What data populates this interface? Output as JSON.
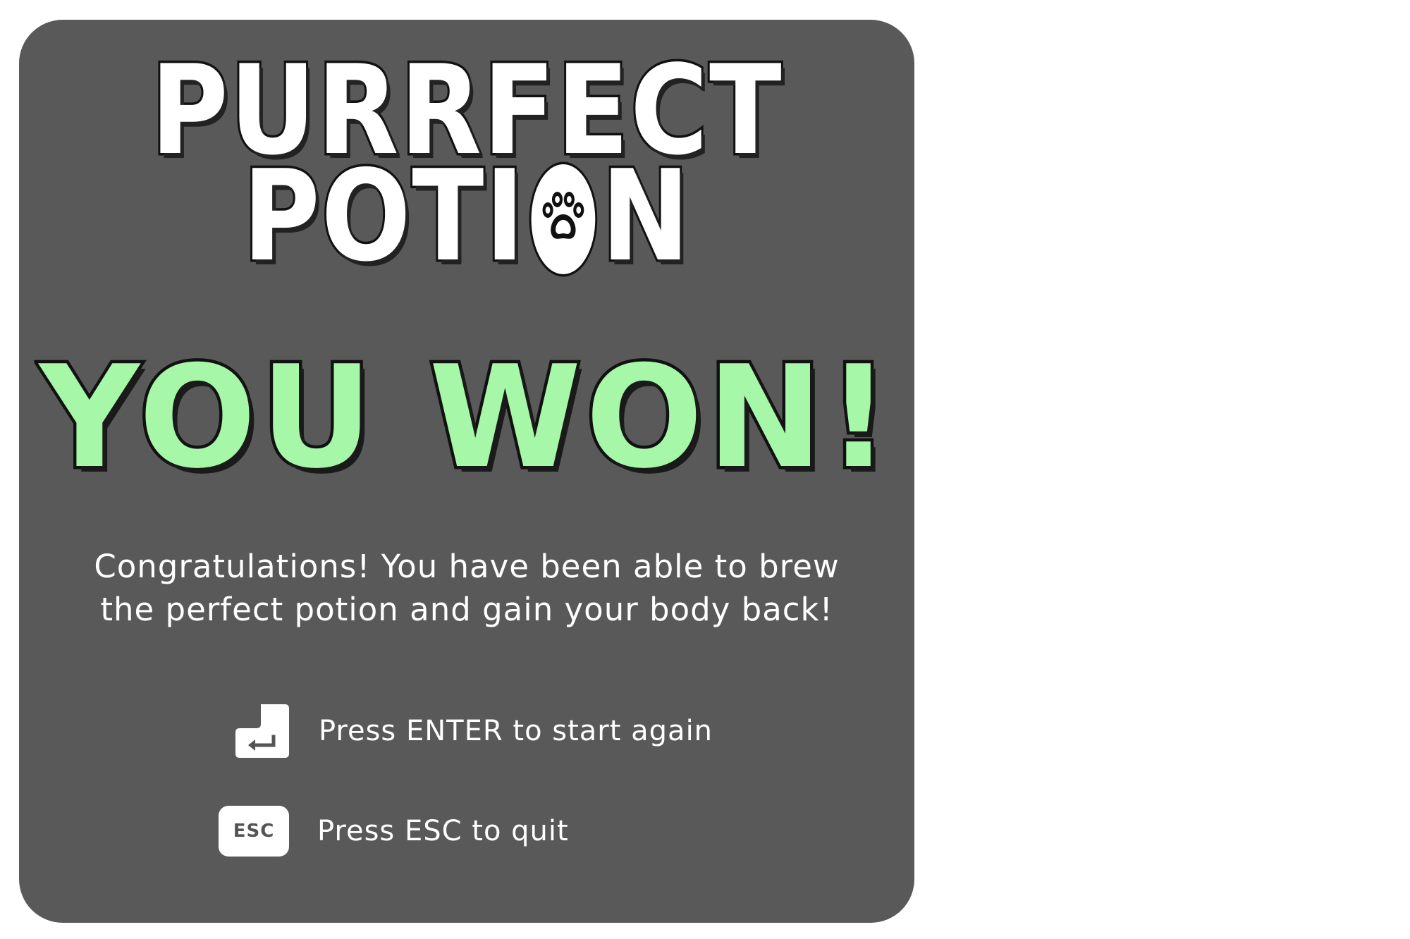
{
  "game": {
    "title_line1": "PURRFECT",
    "title_line2_prefix": "POTI",
    "title_line2_suffix": "N",
    "paw_letter_icon": "paw-icon"
  },
  "result": {
    "headline": "YOU WON!",
    "headline_color": "#a6f7a8",
    "message_line1": "Congratulations! You have been able to brew",
    "message_line2": "the perfect potion and gain your body back!"
  },
  "controls": [
    {
      "key": "ENTER",
      "key_icon": "enter-key-icon",
      "label": "Press ENTER to start again"
    },
    {
      "key": "ESC",
      "key_icon": "esc-key-icon",
      "key_cap_text": "ESC",
      "label": "Press ESC to quit"
    }
  ],
  "colors": {
    "panel_background": "#595959",
    "page_background": "#ffffff",
    "text": "#ffffff",
    "outline": "#111111"
  }
}
